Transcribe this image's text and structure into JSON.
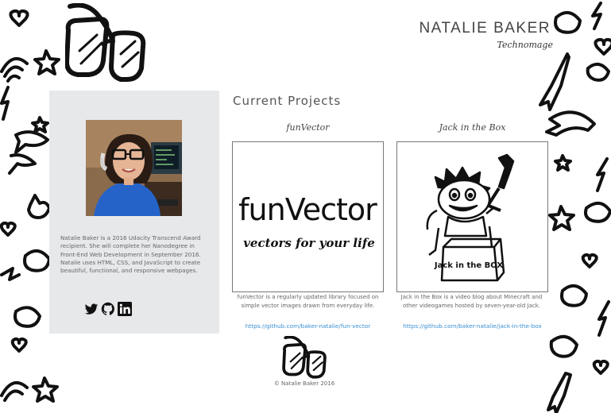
{
  "header": {
    "name": "NATALIE BAKER",
    "tagline": "Technomage"
  },
  "sidebar": {
    "bio": "Natalie Baker is a 2016 Udacity Transcend Award recipient. She will complete her Nanodegree in Front-End Web Development in September 2016. Natalie uses HTML, CSS, and JavaScript to create beautiful, functional, and responsive webpages.",
    "social": [
      {
        "icon": "twitter-icon"
      },
      {
        "icon": "github-icon"
      },
      {
        "icon": "linkedin-icon"
      }
    ]
  },
  "main": {
    "heading": "Current Projects",
    "projects": [
      {
        "title": "funVector",
        "art_title": "funVector",
        "art_subtitle": "vectors for your life",
        "description": "funVector is a regularly updated library focused on simple vector images drawn from everyday life.",
        "link": "https://github.com/baker-natalie/fun-vector"
      },
      {
        "title": "Jack in the Box",
        "art_box_label": "Jack in the BOX",
        "description": "Jack in the Box is a video blog about Minecraft and other videogames hosted by seven-year-old Jack.",
        "link": "https://github.com/baker-natalie/jack-in-the-box"
      }
    ]
  },
  "footer": {
    "copyright": "© Natalie Baker 2016"
  },
  "colors": {
    "sidebar_bg": "#e7e8ea",
    "link": "#3a8fd1",
    "ink": "#111111"
  }
}
